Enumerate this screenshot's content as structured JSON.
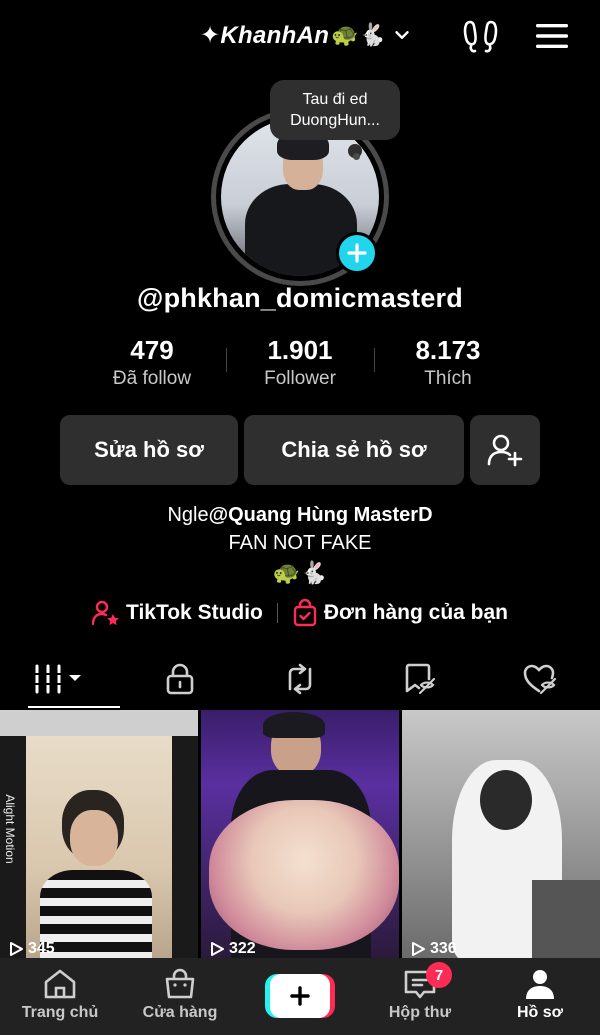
{
  "header": {
    "account_name": "✦KhanhAn",
    "account_emoji": "🐢🐇"
  },
  "profile": {
    "note_bubble": "Tau đi ed DuongHun...",
    "username": "@phkhan_domicmasterd",
    "stats": [
      {
        "value": "479",
        "label": "Đã follow"
      },
      {
        "value": "1.901",
        "label": "Follower"
      },
      {
        "value": "8.173",
        "label": "Thích"
      }
    ],
    "buttons": {
      "edit": "Sửa hồ sơ",
      "share": "Chia sẻ hồ sơ"
    },
    "bio": {
      "line1_prefix": "Ngle",
      "line1_bold": "@Quang Hùng MasterD",
      "line2": "FAN NOT FAKE",
      "line3": "🐢🐇"
    },
    "links": {
      "studio": "TikTok Studio",
      "orders": "Đơn hàng của bạn"
    }
  },
  "videos": [
    {
      "plays": "345",
      "side_text": "Alight Motion"
    },
    {
      "plays": "322"
    },
    {
      "plays": "336"
    }
  ],
  "bottom_nav": {
    "home": "Trang chủ",
    "shop": "Cửa hàng",
    "inbox": "Hộp thư",
    "inbox_badge": "7",
    "profile": "Hồ sơ"
  },
  "colors": {
    "accent_cyan": "#20d5ec",
    "accent_red": "#fe2c55",
    "background": "#000000",
    "button_bg": "#2f2f2f"
  }
}
